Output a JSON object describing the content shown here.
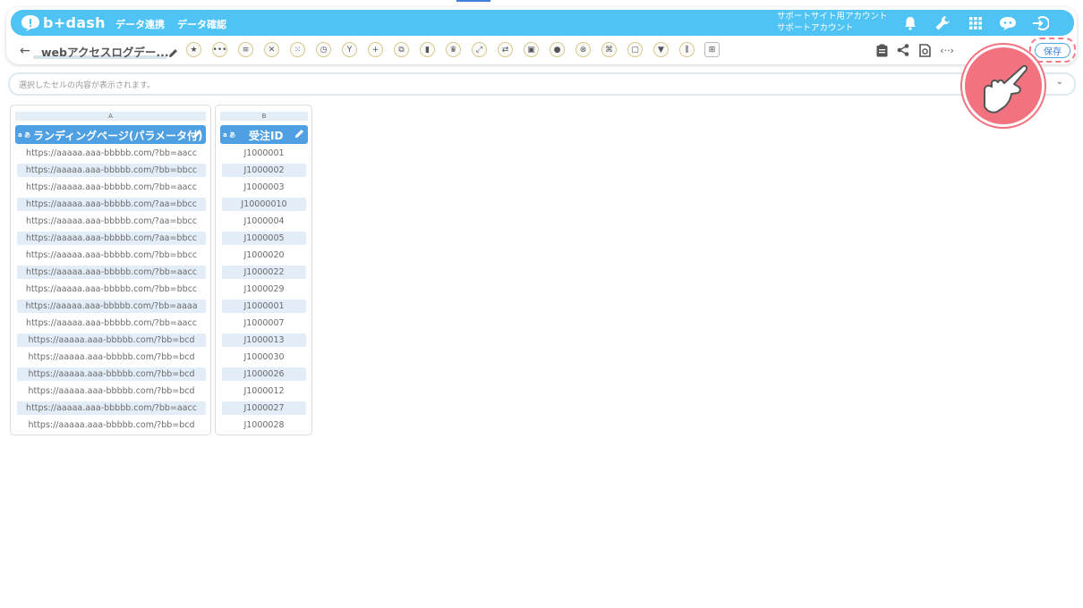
{
  "header": {
    "logo_text": "b+dash",
    "nav": [
      "データ連携",
      "データ確認"
    ],
    "account_line1": "サポートサイト用アカウント",
    "account_line2": "サポートアカウント",
    "accent_color": "#4fc4f4"
  },
  "toolbar": {
    "title": "webアクセスログデー...",
    "save_label": "保存",
    "tool_icons": [
      "star-icon",
      "more-icon",
      "list-icon",
      "tools-icon",
      "cluster-icon",
      "timer-icon",
      "branch-icon",
      "plus-icon",
      "copy-icon",
      "trash-icon",
      "crown-icon",
      "expand-icon",
      "swap-icon",
      "lock-icon",
      "bag-icon",
      "close-icon",
      "image-icon",
      "square-icon",
      "filter-icon",
      "barcode-icon",
      "grid-icon"
    ],
    "right_icons": [
      "clipboard-icon",
      "share-icon",
      "restore-icon",
      "code-icon"
    ]
  },
  "cell_bar": {
    "placeholder": "選択したセルの内容が表示されます。"
  },
  "columns": [
    {
      "letter": "A",
      "type_label": "a あ",
      "name": "ランディングページ(パラメータ付)",
      "cells": [
        "https://aaaaa.aaa-bbbbb.com/?bb=aacc",
        "https://aaaaa.aaa-bbbbb.com/?bb=bbcc",
        "https://aaaaa.aaa-bbbbb.com/?bb=aacc",
        "https://aaaaa.aaa-bbbbb.com/?aa=bbcc",
        "https://aaaaa.aaa-bbbbb.com/?aa=bbcc",
        "https://aaaaa.aaa-bbbbb.com/?aa=bbcc",
        "https://aaaaa.aaa-bbbbb.com/?bb=bbcc",
        "https://aaaaa.aaa-bbbbb.com/?bb=aacc",
        "https://aaaaa.aaa-bbbbb.com/?bb=bbcc",
        "https://aaaaa.aaa-bbbbb.com/?bb=aaaa",
        "https://aaaaa.aaa-bbbbb.com/?bb=aacc",
        "https://aaaaa.aaa-bbbbb.com/?bb=bcd",
        "https://aaaaa.aaa-bbbbb.com/?bb=bcd",
        "https://aaaaa.aaa-bbbbb.com/?bb=bcd",
        "https://aaaaa.aaa-bbbbb.com/?bb=bcd",
        "https://aaaaa.aaa-bbbbb.com/?bb=aacc",
        "https://aaaaa.aaa-bbbbb.com/?bb=bcd"
      ]
    },
    {
      "letter": "B",
      "type_label": "a あ",
      "name": "受注ID",
      "cells": [
        "J1000001",
        "J1000002",
        "J1000003",
        "J10000010",
        "J1000004",
        "J1000005",
        "J1000020",
        "J1000022",
        "J1000029",
        "J1000001",
        "J1000007",
        "J1000013",
        "J1000030",
        "J1000026",
        "J1000012",
        "J1000027",
        "J1000028"
      ]
    }
  ]
}
